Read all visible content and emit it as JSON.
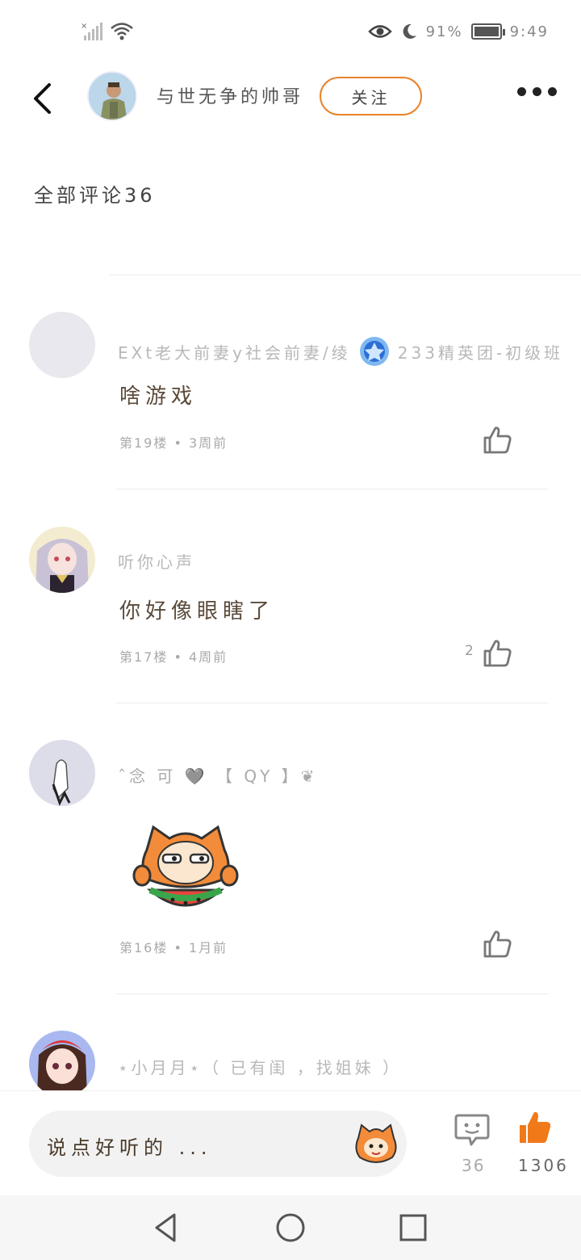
{
  "status_bar": {
    "battery_percent": "91%",
    "time": "9:49"
  },
  "header": {
    "author_name": "与世无争的帅哥",
    "follow_label": "关注"
  },
  "comments_header": "全部评论36",
  "comments": [
    {
      "user_name": "EXt老大前妻y社会前妻/绫",
      "badge_text": "233精英团-初级班",
      "text": "啥游戏",
      "meta": "第19楼 • 3周前",
      "likes": ""
    },
    {
      "user_name": "听你心声",
      "text": "你好像眼瞎了",
      "meta": "第17楼 • 4周前",
      "likes": "2"
    },
    {
      "user_name": "ˆ念 可 🩶 【 QY 】❦",
      "text": "",
      "meta": "第16楼 • 1月前",
      "likes": ""
    },
    {
      "user_name": "⋆小月月⋆（ 已有闺 ，找姐妹 ）",
      "text": "",
      "meta": "",
      "likes": ""
    }
  ],
  "bottom_bar": {
    "input_placeholder": "说点好听的 ...",
    "comment_count": "36",
    "like_count": "1306"
  },
  "colors": {
    "accent_orange": "#f07a1a",
    "follow_border": "#e8822a"
  }
}
